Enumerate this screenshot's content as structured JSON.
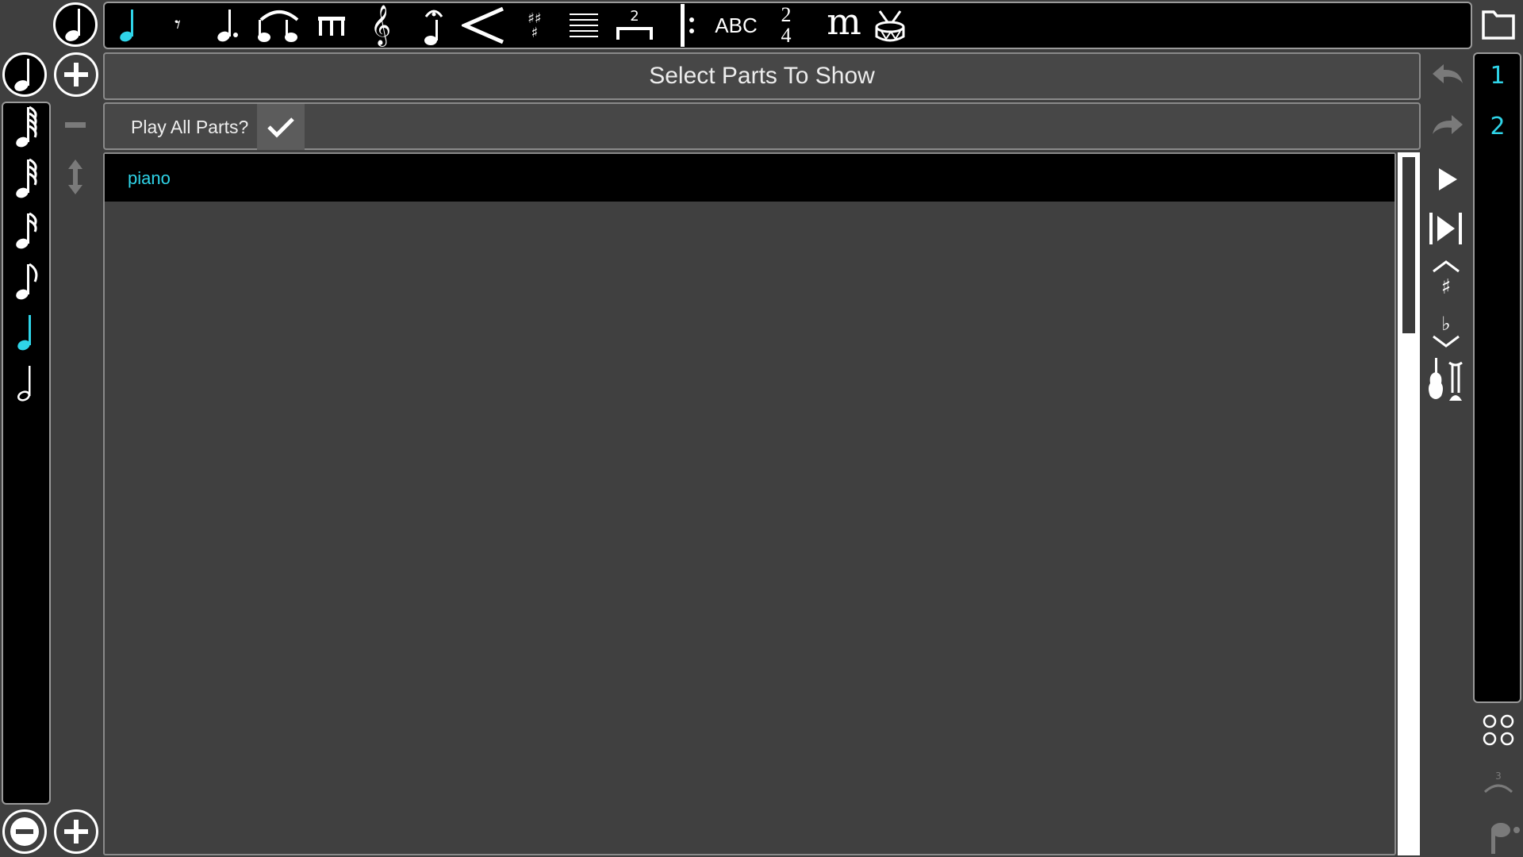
{
  "dialog": {
    "title": "Select Parts To Show",
    "play_all_label": "Play All Parts?",
    "play_all_checked": true
  },
  "parts": [
    {
      "name": "piano",
      "selected": true
    }
  ],
  "top_toolbar": {
    "text_tool_label": "ABC",
    "time_sig_top": "2",
    "time_sig_bottom": "4",
    "tuplet_number": "2",
    "dynamic_label": "m",
    "active_tool": "quarter-note"
  },
  "page_numbers": [
    "1",
    "2"
  ],
  "triplet_label": "3",
  "colors": {
    "accent": "#2fd4e8",
    "background": "#3f3f3f",
    "panel": "#000000",
    "icon": "#ffffff",
    "disabled": "#7a7a7a"
  }
}
